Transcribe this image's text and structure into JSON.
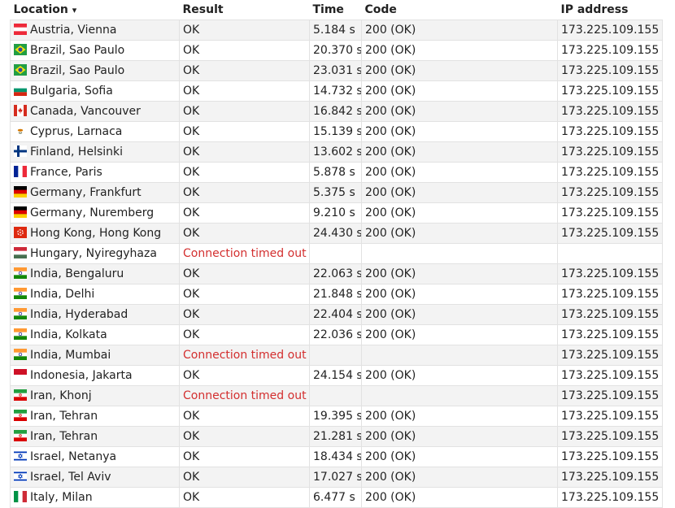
{
  "headers": {
    "location": "Location",
    "sort_indicator": "▾",
    "result": "Result",
    "time": "Time",
    "code": "Code",
    "ip": "IP address"
  },
  "rows": [
    {
      "flag": "austria",
      "location": "Austria, Vienna",
      "result": "OK",
      "time": "5.184 s",
      "code": "200 (OK)",
      "ip": "173.225.109.155"
    },
    {
      "flag": "brazil",
      "location": "Brazil, Sao Paulo",
      "result": "OK",
      "time": "20.370 s",
      "code": "200 (OK)",
      "ip": "173.225.109.155"
    },
    {
      "flag": "brazil",
      "location": "Brazil, Sao Paulo",
      "result": "OK",
      "time": "23.031 s",
      "code": "200 (OK)",
      "ip": "173.225.109.155"
    },
    {
      "flag": "bulgaria",
      "location": "Bulgaria, Sofia",
      "result": "OK",
      "time": "14.732 s",
      "code": "200 (OK)",
      "ip": "173.225.109.155"
    },
    {
      "flag": "canada",
      "location": "Canada, Vancouver",
      "result": "OK",
      "time": "16.842 s",
      "code": "200 (OK)",
      "ip": "173.225.109.155"
    },
    {
      "flag": "cyprus",
      "location": "Cyprus, Larnaca",
      "result": "OK",
      "time": "15.139 s",
      "code": "200 (OK)",
      "ip": "173.225.109.155"
    },
    {
      "flag": "finland",
      "location": "Finland, Helsinki",
      "result": "OK",
      "time": "13.602 s",
      "code": "200 (OK)",
      "ip": "173.225.109.155"
    },
    {
      "flag": "france",
      "location": "France, Paris",
      "result": "OK",
      "time": "5.878 s",
      "code": "200 (OK)",
      "ip": "173.225.109.155"
    },
    {
      "flag": "germany",
      "location": "Germany, Frankfurt",
      "result": "OK",
      "time": "5.375 s",
      "code": "200 (OK)",
      "ip": "173.225.109.155"
    },
    {
      "flag": "germany",
      "location": "Germany, Nuremberg",
      "result": "OK",
      "time": "9.210 s",
      "code": "200 (OK)",
      "ip": "173.225.109.155"
    },
    {
      "flag": "hongkong",
      "location": "Hong Kong, Hong Kong",
      "result": "OK",
      "time": "24.430 s",
      "code": "200 (OK)",
      "ip": "173.225.109.155"
    },
    {
      "flag": "hungary",
      "location": "Hungary, Nyiregyhaza",
      "result": "Connection timed out",
      "error": true,
      "time": "",
      "code": "",
      "ip": ""
    },
    {
      "flag": "india",
      "location": "India, Bengaluru",
      "result": "OK",
      "time": "22.063 s",
      "code": "200 (OK)",
      "ip": "173.225.109.155"
    },
    {
      "flag": "india",
      "location": "India, Delhi",
      "result": "OK",
      "time": "21.848 s",
      "code": "200 (OK)",
      "ip": "173.225.109.155"
    },
    {
      "flag": "india",
      "location": "India, Hyderabad",
      "result": "OK",
      "time": "22.404 s",
      "code": "200 (OK)",
      "ip": "173.225.109.155"
    },
    {
      "flag": "india",
      "location": "India, Kolkata",
      "result": "OK",
      "time": "22.036 s",
      "code": "200 (OK)",
      "ip": "173.225.109.155"
    },
    {
      "flag": "india",
      "location": "India, Mumbai",
      "result": "Connection timed out",
      "error": true,
      "time": "",
      "code": "",
      "ip": "173.225.109.155"
    },
    {
      "flag": "indonesia",
      "location": "Indonesia, Jakarta",
      "result": "OK",
      "time": "24.154 s",
      "code": "200 (OK)",
      "ip": "173.225.109.155"
    },
    {
      "flag": "iran",
      "location": "Iran, Khonj",
      "result": "Connection timed out",
      "error": true,
      "time": "",
      "code": "",
      "ip": "173.225.109.155"
    },
    {
      "flag": "iran",
      "location": "Iran, Tehran",
      "result": "OK",
      "time": "19.395 s",
      "code": "200 (OK)",
      "ip": "173.225.109.155"
    },
    {
      "flag": "iran",
      "location": "Iran, Tehran",
      "result": "OK",
      "time": "21.281 s",
      "code": "200 (OK)",
      "ip": "173.225.109.155"
    },
    {
      "flag": "israel",
      "location": "Israel, Netanya",
      "result": "OK",
      "time": "18.434 s",
      "code": "200 (OK)",
      "ip": "173.225.109.155"
    },
    {
      "flag": "israel",
      "location": "Israel, Tel Aviv",
      "result": "OK",
      "time": "17.027 s",
      "code": "200 (OK)",
      "ip": "173.225.109.155"
    },
    {
      "flag": "italy",
      "location": "Italy, Milan",
      "result": "OK",
      "time": "6.477 s",
      "code": "200 (OK)",
      "ip": "173.225.109.155"
    }
  ],
  "colors": {
    "error": "#d32f2f",
    "row_alt": "#f3f3f3",
    "border": "#e2e2e2"
  }
}
